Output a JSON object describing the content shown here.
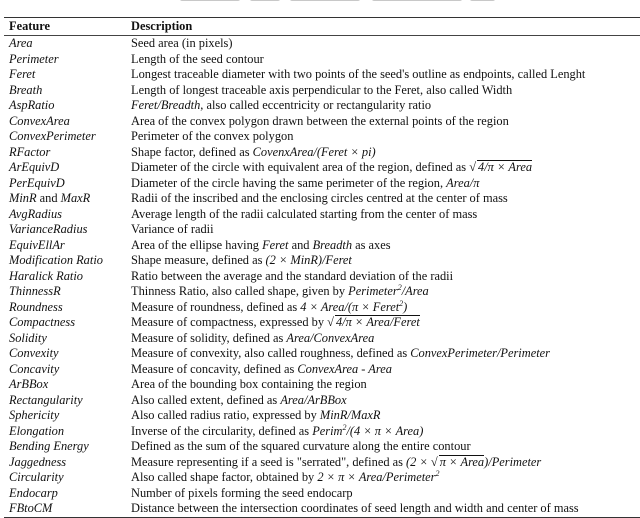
{
  "table": {
    "headers": [
      "Feature",
      "Description"
    ],
    "rows": [
      {
        "feature": "Area",
        "description": "Seed area (in pixels)"
      },
      {
        "feature": "Perimeter",
        "description": "Length of the seed contour"
      },
      {
        "feature": "Feret",
        "description": "Longest traceable diameter with two points of the seed's outline as endpoints, called Lenght"
      },
      {
        "feature": "Breath",
        "description": "Length of longest traceable axis perpendicular to the Feret, also called Width"
      },
      {
        "feature": "AspRatio",
        "description_math": "Feret/Breadth",
        "description": ", also called eccentricity or rectangularity ratio"
      },
      {
        "feature": "ConvexArea",
        "description": "Area of the convex polygon drawn between the external points of the region"
      },
      {
        "feature": "ConvexPerimeter",
        "description": "Perimeter of the convex polygon"
      },
      {
        "feature": "RFactor",
        "description": "Shape factor, defined as ",
        "description_math": "CovenxArea/(Feret × pi)"
      },
      {
        "feature": "ArEquivD",
        "description": "Diameter of the circle with equivalent area of the region, defined as ",
        "description_sqrt": "4/π × Area"
      },
      {
        "feature": "PerEquivD",
        "description": "Diameter of the circle having the same perimeter of the region, ",
        "description_math": "Area/π"
      },
      {
        "feature_a": "MinR",
        "feature_join": " and ",
        "feature_b": "MaxR",
        "description": "Radii of the inscribed and the enclosing circles centred at the center of mass"
      },
      {
        "feature": "AvgRadius",
        "description": "Average length of the radii calculated starting from the center of mass"
      },
      {
        "feature": "VarianceRadius",
        "description": "Variance of radii"
      },
      {
        "feature": "EquivEllAr",
        "description_pre": "Area of the ellipse having ",
        "description_math_a": "Feret",
        "description_mid": " and ",
        "description_math_b": "Breadth",
        "description_post": " as axes"
      },
      {
        "feature": "Modification Ratio",
        "description": "Shape measure, defined as ",
        "description_math": "(2 × MinR)/Feret"
      },
      {
        "feature": "Haralick Ratio",
        "description": "Ratio between the average and the standard deviation of the radii"
      },
      {
        "feature": "ThinnessR",
        "description": "Thinness Ratio, also called shape, given by ",
        "description_math": "Perimeter",
        "description_sup": "2",
        "description_math_post": "/Area"
      },
      {
        "feature": "Roundness",
        "description": "Measure of roundness, defined as ",
        "description_math": "4 × Area/(π × Feret",
        "description_sup": "2",
        "description_math_post": ")"
      },
      {
        "feature": "Compactness",
        "description": "Measure of compactness, expressed by ",
        "description_sqrt": "4/π × Area/Feret"
      },
      {
        "feature": "Solidity",
        "description": "Measure of solidity, defined as ",
        "description_math": "Area/ConvexArea"
      },
      {
        "feature": "Convexity",
        "description": "Measure of convexity, also called roughness, defined as ",
        "description_math": "ConvexPerimeter/Perimeter"
      },
      {
        "feature": "Concavity",
        "description": "Measure of concavity, defined as ",
        "description_math": "ConvexArea - Area"
      },
      {
        "feature": "ArBBox",
        "description": "Area of the bounding box containing the region"
      },
      {
        "feature": "Rectangularity",
        "description": "Also called extent, defined as ",
        "description_math": "Area/ArBBox"
      },
      {
        "feature": "Sphericity",
        "description": "Also called radius ratio, expressed by ",
        "description_math": "MinR/MaxR"
      },
      {
        "feature": "Elongation",
        "description": "Inverse of the circularity, defined as ",
        "description_math": "Perim",
        "description_sup": "2",
        "description_math_post": "/(4 × π × Area)"
      },
      {
        "feature": "Bending Energy",
        "description": "Defined as the sum of the squared curvature along the entire contour"
      },
      {
        "feature": "Jaggedness",
        "description": "Measure representing if a seed is \"serrated\", defined as ",
        "description_math": "(2 × ",
        "description_sqrt": "π × Area",
        "description_math_post": ")/Perimeter"
      },
      {
        "feature": "Circularity",
        "description": "Also called shape factor, obtained by ",
        "description_math": "2 × π × Area/Perimeter",
        "description_sup": "2"
      },
      {
        "feature": "Endocarp",
        "description": "Number of pixels forming the seed endocarp"
      },
      {
        "feature": "FBtoCM",
        "description": "Distance between the intersection coordinates of seed length and width and center of mass"
      }
    ]
  }
}
